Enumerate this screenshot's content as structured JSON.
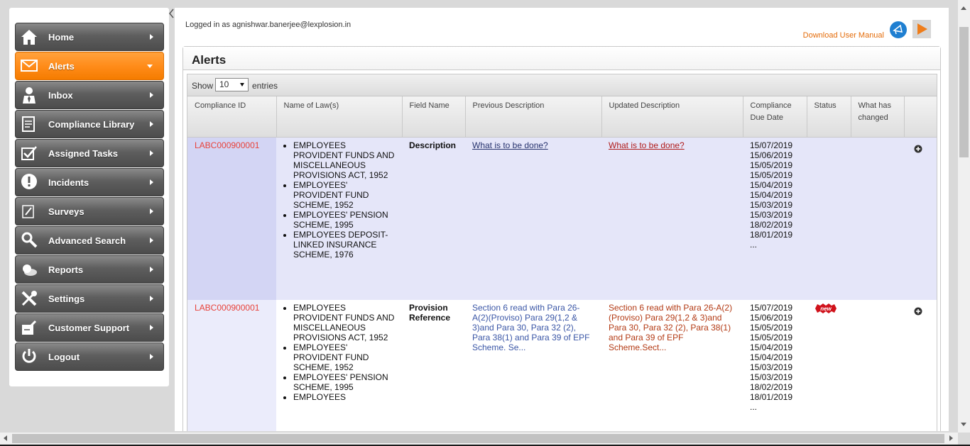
{
  "colors": {
    "accent": "#ff8c1a",
    "link_red": "#e8433b",
    "nav_gray": "#5e5e5e"
  },
  "sidebar": {
    "items": [
      {
        "label": "Home",
        "icon": "home-icon"
      },
      {
        "label": "Alerts",
        "icon": "envelope-icon",
        "active": true
      },
      {
        "label": "Inbox",
        "icon": "user-icon"
      },
      {
        "label": "Compliance Library",
        "icon": "document-icon"
      },
      {
        "label": "Assigned Tasks",
        "icon": "checkbox-icon"
      },
      {
        "label": "Incidents",
        "icon": "exclamation-icon"
      },
      {
        "label": "Surveys",
        "icon": "pencil-icon"
      },
      {
        "label": "Advanced Search",
        "icon": "search-icon"
      },
      {
        "label": "Reports",
        "icon": "pie-chart-icon"
      },
      {
        "label": "Settings",
        "icon": "tools-icon"
      },
      {
        "label": "Customer Support",
        "icon": "support-icon"
      },
      {
        "label": "Logout",
        "icon": "power-icon"
      }
    ]
  },
  "header": {
    "logged_in": "Logged in as agnishwar.banerjee@lexplosion.in",
    "download_manual": "Download User Manual"
  },
  "alerts": {
    "title": "Alerts",
    "length_menu": {
      "show": "Show",
      "value": "10",
      "entries": "entries"
    },
    "columns": [
      "Compliance ID",
      "Name of Law(s)",
      "Field Name",
      "Previous Description",
      "Updated Description",
      "Compliance Due Date",
      "Status",
      "What has changed",
      ""
    ],
    "rows": [
      {
        "id": "LABC000900001",
        "laws": [
          "EMPLOYEES PROVIDENT FUNDS AND MISCELLANEOUS PROVISIONS ACT, 1952",
          "EMPLOYEES' PROVIDENT FUND SCHEME, 1952",
          "EMPLOYEES' PENSION SCHEME, 1995",
          "EMPLOYEES DEPOSIT-LINKED INSURANCE SCHEME, 1976"
        ],
        "field": "Description",
        "previous": "What is to be done?",
        "updated": "What is to be done?",
        "due_dates": [
          "15/07/2019",
          "15/06/2019",
          "15/05/2019",
          "15/05/2019",
          "15/04/2019",
          "15/04/2019",
          "15/03/2019",
          "15/03/2019",
          "18/02/2019",
          "18/01/2019",
          "..."
        ],
        "status": "",
        "changed": ""
      },
      {
        "id": "LABC000900001",
        "laws": [
          "EMPLOYEES PROVIDENT FUNDS AND MISCELLANEOUS PROVISIONS ACT, 1952",
          "EMPLOYEES' PROVIDENT FUND SCHEME, 1952",
          "EMPLOYEES' PENSION SCHEME, 1995",
          "EMPLOYEES"
        ],
        "field": "Provision Reference",
        "previous": "Section 6 read with Para 26-A(2)(Proviso) Para 29(1,2 & 3)and Para 30, Para 32 (2), Para 38(1) and Para 39 of EPF Scheme. Se...",
        "updated": "Section 6 read with Para 26-A(2)(Proviso) Para 29(1,2 & 3)and Para 30, Para 32 (2), Para 38(1) and Para 39 of EPF Scheme.Sect...",
        "due_dates": [
          "15/07/2019",
          "15/06/2019",
          "15/05/2019",
          "15/05/2019",
          "15/04/2019",
          "15/04/2019",
          "15/03/2019",
          "15/03/2019",
          "18/02/2019",
          "18/01/2019",
          "..."
        ],
        "status": "new",
        "changed": ""
      }
    ]
  }
}
